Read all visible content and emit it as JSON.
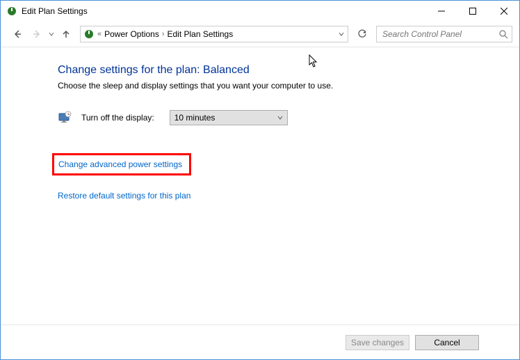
{
  "window": {
    "title": "Edit Plan Settings"
  },
  "breadcrumb": {
    "item1": "Power Options",
    "item2": "Edit Plan Settings"
  },
  "search": {
    "placeholder": "Search Control Panel"
  },
  "main": {
    "heading": "Change settings for the plan: Balanced",
    "subheading": "Choose the sleep and display settings that you want your computer to use.",
    "display_label": "Turn off the display:",
    "display_value": "10 minutes",
    "link_advanced": "Change advanced power settings",
    "link_restore": "Restore default settings for this plan"
  },
  "footer": {
    "save": "Save changes",
    "cancel": "Cancel"
  }
}
